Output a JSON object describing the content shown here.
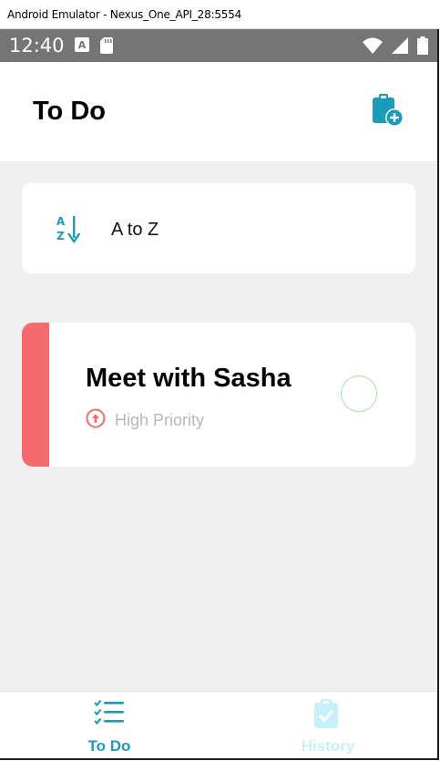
{
  "window": {
    "title": "Android Emulator - Nexus_One_API_28:5554"
  },
  "status_bar": {
    "time": "12:40"
  },
  "header": {
    "title": "To Do"
  },
  "sort": {
    "label": "A to Z"
  },
  "tasks": [
    {
      "title": "Meet with Sasha",
      "priority": "High Priority",
      "priority_color": "#f46a6d"
    }
  ],
  "nav": {
    "tabs": [
      {
        "label": "To Do",
        "active": true,
        "color": "#1a9bb8"
      },
      {
        "label": "History",
        "active": false,
        "color": "#c6f1fb"
      }
    ]
  },
  "colors": {
    "accent": "#1a9bb8",
    "background": "#f0f0f0",
    "status_bar": "#757575"
  }
}
